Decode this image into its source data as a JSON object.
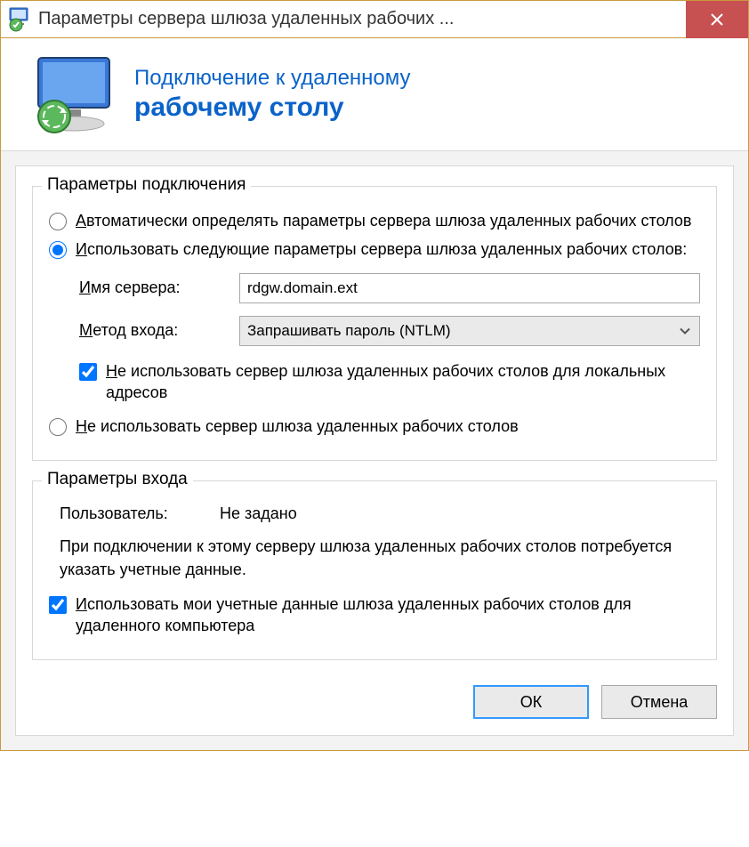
{
  "window": {
    "title": "Параметры сервера шлюза удаленных рабочих ..."
  },
  "header": {
    "line1": "Подключение к удаленному",
    "line2": "рабочему столу"
  },
  "connection_group": {
    "legend": "Параметры подключения",
    "auto_detect": {
      "prefix": "А",
      "rest": "втоматически определять параметры сервера шлюза удаленных рабочих столов"
    },
    "use_settings": {
      "prefix": "И",
      "rest": "спользовать следующие параметры сервера шлюза удаленных рабочих столов:"
    },
    "server_label_prefix": "И",
    "server_label_rest": "мя сервера:",
    "server_value": "rdgw.domain.ext",
    "method_label_prefix": "М",
    "method_label_rest": "етод входа:",
    "method_value": "Запрашивать пароль (NTLM)",
    "bypass_local": {
      "prefix": "Н",
      "rest": "е использовать сервер шлюза удаленных рабочих столов для локальных адресов"
    },
    "no_gateway": {
      "prefix": "Н",
      "rest": "е использовать сервер шлюза удаленных рабочих столов"
    }
  },
  "login_group": {
    "legend": "Параметры входа",
    "user_label": "Пользователь:",
    "user_value": "Не задано",
    "note": "При подключении к этому серверу шлюза удаленных рабочих столов потребуется указать учетные данные.",
    "use_creds": {
      "prefix": "И",
      "rest": "спользовать мои учетные данные шлюза удаленных рабочих столов для удаленного компьютера"
    }
  },
  "buttons": {
    "ok": "ОК",
    "cancel": "Отмена"
  }
}
